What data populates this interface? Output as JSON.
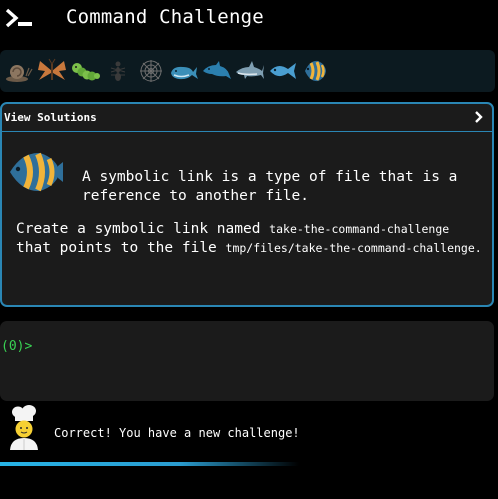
{
  "header": {
    "title": "Command Challenge",
    "icon": "terminal-prompt-icon"
  },
  "levels": [
    {
      "name": "snail-icon",
      "state": "completed"
    },
    {
      "name": "butterfly-icon",
      "state": "completed"
    },
    {
      "name": "caterpillar-icon",
      "state": "completed"
    },
    {
      "name": "ant-icon",
      "state": "completed"
    },
    {
      "name": "spider-web-icon",
      "state": "completed"
    },
    {
      "name": "whale-icon",
      "state": "completed"
    },
    {
      "name": "dolphin-icon",
      "state": "completed"
    },
    {
      "name": "shark-icon",
      "state": "completed"
    },
    {
      "name": "fish-icon",
      "state": "completed"
    },
    {
      "name": "tropical-fish-icon",
      "state": "current"
    }
  ],
  "card": {
    "view_solutions_label": "View Solutions",
    "intro": "A symbolic link is a type of file that is a reference to another file.",
    "task_prefix": "Create a symbolic link named ",
    "link_name": "take-the-command-challenge",
    "task_middle": " that points to the file ",
    "target_file": "tmp/files/take-the-command-challenge",
    "task_suffix": "."
  },
  "terminal": {
    "prompt": "(0)>"
  },
  "feedback": {
    "message": "Correct! You have a new challenge!",
    "progress": 0.6
  },
  "colors": {
    "background": "#000000",
    "card_background": "#1b1b1b",
    "accent_border": "#2a86b4",
    "prompt_green": "#39d353",
    "level_strip": "#0c1a20"
  }
}
